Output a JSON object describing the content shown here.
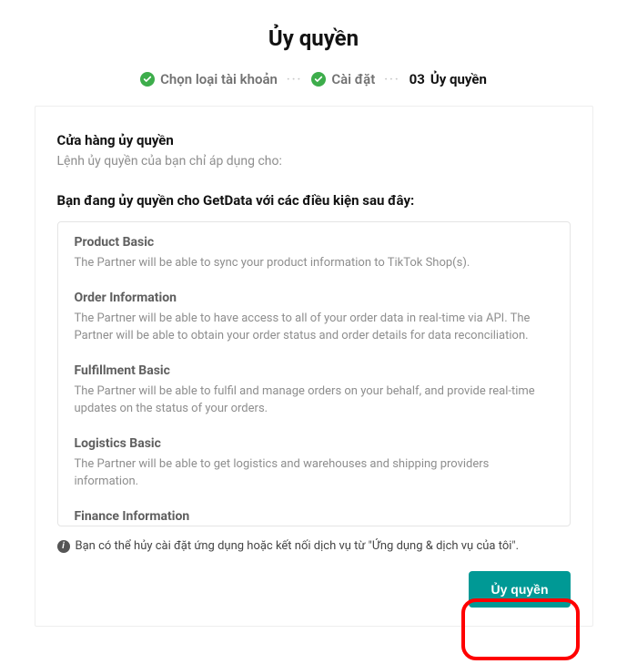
{
  "header": {
    "title": "Ủy quyền"
  },
  "stepper": {
    "step1": "Chọn loại tài khoản",
    "step2": "Cài đặt",
    "step3_num": "03",
    "step3_label": "Ủy quyền"
  },
  "card": {
    "heading": "Cửa hàng ủy quyền",
    "sub": "Lệnh ủy quyền của bạn chỉ áp dụng cho:",
    "conditions_title": "Bạn đang ủy quyền cho GetData với các điều kiện sau đây:"
  },
  "permissions": [
    {
      "title": "Product Basic",
      "desc": "The Partner will be able to sync your product information to TikTok Shop(s)."
    },
    {
      "title": "Order Information",
      "desc": "The Partner will be able to have access to all of your order data in real-time via API. The Partner will be able to obtain your order status and order details for data reconciliation."
    },
    {
      "title": "Fulfillment Basic",
      "desc": "The Partner will be able to fulfil and manage orders on your behalf, and provide real-time updates on the status of your orders."
    },
    {
      "title": "Logistics Basic",
      "desc": "The Partner will be able to get logistics and warehouses and shipping providers information."
    },
    {
      "title": "Finance Information",
      "desc": ""
    }
  ],
  "footer": {
    "info_text": "Bạn có thể hủy cài đặt ứng dụng hoặc kết nối dịch vụ từ \"Ứng dụng & dịch vụ của tôi\"."
  },
  "actions": {
    "authorize_label": "Ủy quyền"
  }
}
